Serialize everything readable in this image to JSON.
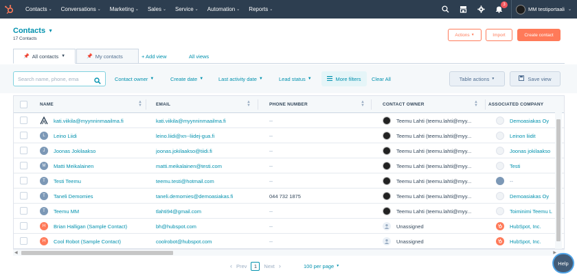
{
  "topnav": {
    "items": [
      {
        "label": "Contacts"
      },
      {
        "label": "Conversations"
      },
      {
        "label": "Marketing"
      },
      {
        "label": "Sales"
      },
      {
        "label": "Service"
      },
      {
        "label": "Automation"
      },
      {
        "label": "Reports"
      }
    ],
    "notification_count": "3",
    "account_name": "MM testiportaali",
    "brand_color": "#2d3e50"
  },
  "header": {
    "title": "Contacts",
    "subtitle": "17 Contacts",
    "actions_label": "Actions",
    "import_label": "Import",
    "create_label": "Create contact"
  },
  "tabs": {
    "active": "All contacts",
    "inactive": "My contacts",
    "add_view": "+ Add view",
    "all_views": "All views"
  },
  "filters": {
    "search_placeholder": "Search name, phone, ema",
    "contact_owner": "Contact owner",
    "create_date": "Create date",
    "last_activity": "Last activity date",
    "lead_status": "Lead status",
    "more_filters": "More filters",
    "clear_all": "Clear All",
    "table_actions": "Table actions",
    "save_view": "Save view"
  },
  "table": {
    "columns": [
      "NAME",
      "EMAIL",
      "PHONE NUMBER",
      "CONTACT OWNER",
      "ASSOCIATED COMPANY"
    ],
    "rows": [
      {
        "avatar": "",
        "avatar_type": "logo",
        "name": "kati.viikila@myynninmaailma.fi",
        "email": "kati.viikila@myynninmaailma.fi",
        "phone": "--",
        "owner": "Teemu Lahti (teemu.lahti@myy...",
        "owner_type": "photo",
        "company": "Demoasiakas Oy",
        "company_type": "logo"
      },
      {
        "avatar": "L",
        "avatar_type": "grey",
        "name": "Leino Liidi",
        "email": "leino.liidi@xn--liidej-gua.fi",
        "phone": "--",
        "owner": "Teemu Lahti (teemu.lahti@myy...",
        "owner_type": "photo",
        "company": "Leinon liidit",
        "company_type": "logo"
      },
      {
        "avatar": "J",
        "avatar_type": "grey",
        "name": "Joonas Jokilaakso",
        "email": "joonas.jokilaakso@tiidi.fi",
        "phone": "--",
        "owner": "Teemu Lahti (teemu.lahti@myy...",
        "owner_type": "photo",
        "company": "Joonas jokilaakso",
        "company_type": "logo"
      },
      {
        "avatar": "M",
        "avatar_type": "grey",
        "name": "Matti Meikalainen",
        "email": "matti.meikalainen@testi.com",
        "phone": "--",
        "owner": "Teemu Lahti (teemu.lahti@myy...",
        "owner_type": "photo",
        "company": "Testi",
        "company_type": "logo"
      },
      {
        "avatar": "T",
        "avatar_type": "grey",
        "name": "Testi Teemu",
        "email": "teemu.testi@hotmail.com",
        "phone": "--",
        "owner": "Teemu Lahti (teemu.lahti@myy...",
        "owner_type": "photo",
        "company": "--",
        "company_type": "grey"
      },
      {
        "avatar": "T",
        "avatar_type": "grey",
        "name": "Taneli Demomies",
        "email": "taneli.demomies@demoasiakas.fi",
        "phone": "044 732 1875",
        "owner": "Teemu Lahti (teemu.lahti@myy...",
        "owner_type": "photo",
        "company": "Demoasiakas Oy",
        "company_type": "logo"
      },
      {
        "avatar": "T",
        "avatar_type": "grey",
        "name": "Teemu MM",
        "email": "tlahti94@gmail.com",
        "phone": "--",
        "owner": "Teemu Lahti (teemu.lahti@myy...",
        "owner_type": "photo",
        "company": "Toiminimi Teemu L",
        "company_type": "logo"
      },
      {
        "avatar": "H",
        "avatar_type": "orange",
        "name": "Brian Halligan (Sample Contact)",
        "email": "bh@hubspot.com",
        "phone": "--",
        "owner": "Unassigned",
        "owner_type": "unassigned",
        "company": "HubSpot, Inc.",
        "company_type": "hubspot"
      },
      {
        "avatar": "H",
        "avatar_type": "orange",
        "name": "Cool Robot (Sample Contact)",
        "email": "coolrobot@hubspot.com",
        "phone": "--",
        "owner": "Unassigned",
        "owner_type": "unassigned",
        "company": "HubSpot, Inc.",
        "company_type": "hubspot"
      }
    ]
  },
  "pagination": {
    "prev": "Prev",
    "current": "1",
    "next": "Next",
    "per_page": "100 per page"
  },
  "help_label": "Help"
}
